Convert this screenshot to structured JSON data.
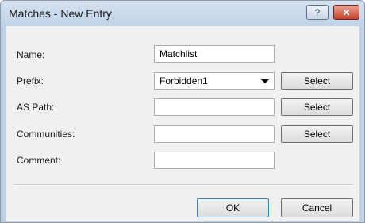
{
  "window": {
    "title": "Matches - New Entry"
  },
  "titlebar": {
    "help_label": "?",
    "close_label": "✕"
  },
  "form": {
    "name": {
      "label": "Name:",
      "value": "Matchlist"
    },
    "prefix": {
      "label": "Prefix:",
      "value": "Forbidden1",
      "button": "Select"
    },
    "as_path": {
      "label": "AS Path:",
      "value": "",
      "button": "Select"
    },
    "communities": {
      "label": "Communities:",
      "value": "",
      "button": "Select"
    },
    "comment": {
      "label": "Comment:",
      "value": ""
    }
  },
  "footer": {
    "ok_label": "OK",
    "cancel_label": "Cancel"
  },
  "icons": {
    "dropdown": "chevron-down-icon",
    "help": "help-icon",
    "close": "close-icon"
  }
}
